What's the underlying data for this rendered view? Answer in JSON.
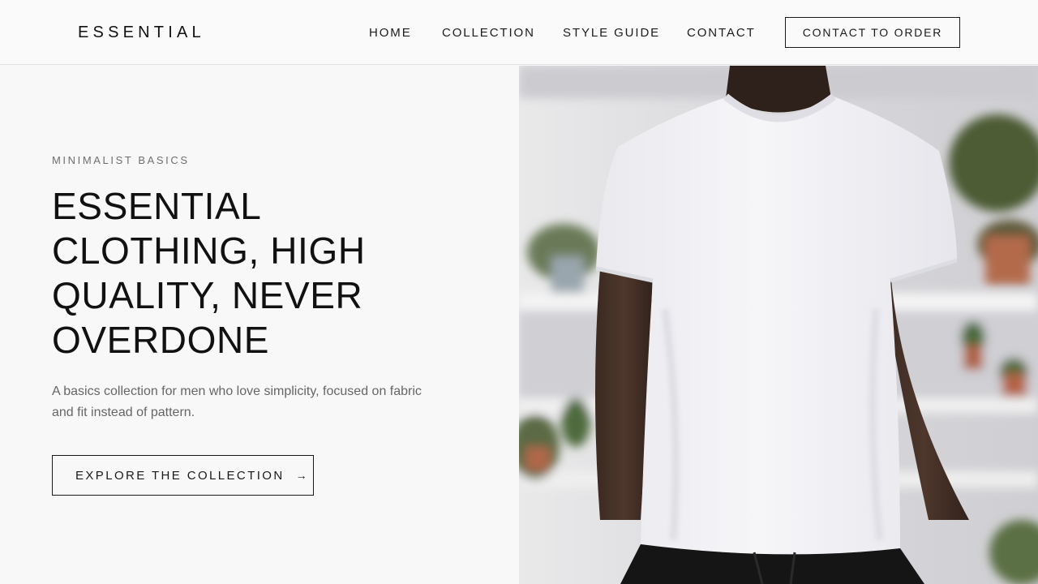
{
  "header": {
    "logo": "ESSENTIAL",
    "nav": {
      "home": "HOME",
      "collection": "COLLECTION",
      "style_guide": "STYLE GUIDE",
      "contact": "CONTACT"
    },
    "cta": "CONTACT TO ORDER"
  },
  "hero": {
    "eyebrow": "MINIMALIST BASICS",
    "headline_lines": [
      "ESSENTIAL",
      "CLOTHING, HIGH",
      "QUALITY, NEVER",
      "OVERDONE"
    ],
    "description": "A basics collection for men who love simplicity, focused on fabric and fit instead of pattern.",
    "cta_label": "EXPLORE THE COLLECTION",
    "cta_arrow": "→"
  },
  "colors": {
    "background": "#f8f8f8",
    "text": "#141414",
    "muted": "#6e6e6e",
    "border": "#1a1a1a"
  },
  "icons": {
    "cta_arrow": "right-arrow-icon"
  }
}
